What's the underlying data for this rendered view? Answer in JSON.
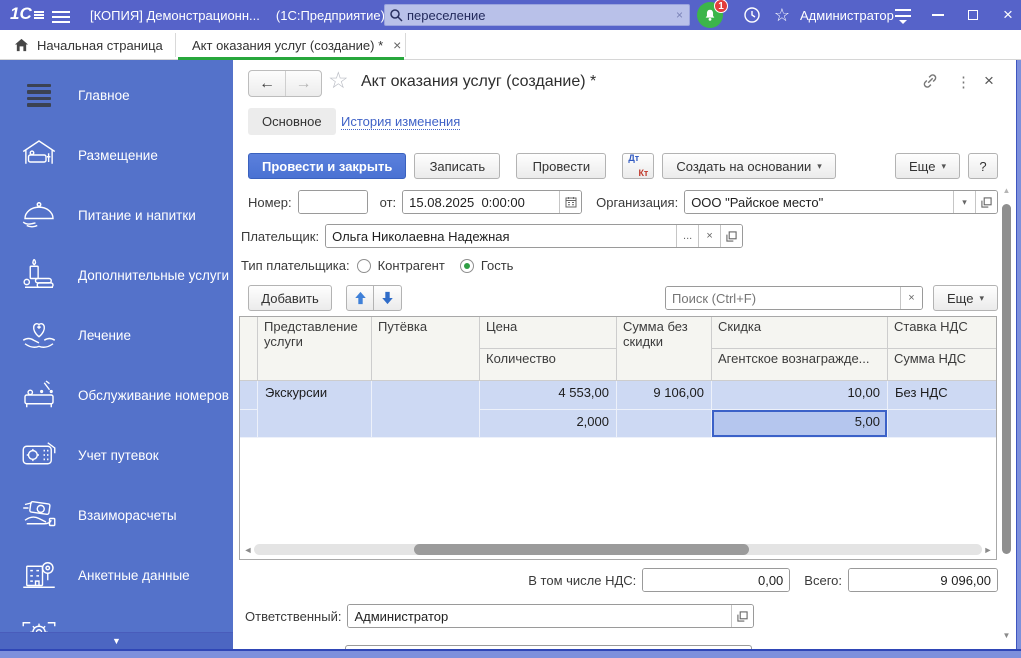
{
  "colors": {
    "topbar": "#5663c9",
    "sidebar": "#5472ca",
    "tab_accent_green": "#27a73c",
    "primary_button": "#4a72d3",
    "row_selection": "#cdd9f3",
    "selected_cell": "#b5c6ee",
    "notification_green": "#3cb54a",
    "badge_red": "#e23d3d"
  },
  "glyphs": {
    "back": "←",
    "forward": "→",
    "dropdown": "▾",
    "close": "×",
    "star": "☆",
    "kebab": "⋮",
    "left_arrow": "◄",
    "right_arrow": "►",
    "up_small": "▲",
    "down_small": "▼",
    "expander": "▼",
    "ellipsis": "..."
  },
  "titlebar": {
    "logo": "1С",
    "app_title_left": "[КОПИЯ] Демонстрационн...",
    "app_title_right": "(1С:Предприятие)",
    "search_value": "переселение",
    "notification_badge": "1",
    "user": "Администратор"
  },
  "tabbar": {
    "home_label": "Начальная страница",
    "active_tab_label": "Акт оказания услуг (создание) *"
  },
  "sidebar": {
    "items": [
      {
        "icon": "menu-icon",
        "label": "Главное"
      },
      {
        "icon": "bed-icon",
        "label": "Размещение"
      },
      {
        "icon": "cloche-icon",
        "label": "Питание и напитки"
      },
      {
        "icon": "spa-icon",
        "label": "Дополнительные услуги"
      },
      {
        "icon": "heart-hands-icon",
        "label": "Лечение"
      },
      {
        "icon": "housekeeping-icon",
        "label": "Обслуживание номеров"
      },
      {
        "icon": "voucher-icon",
        "label": "Учет путевок"
      },
      {
        "icon": "payments-icon",
        "label": "Взаиморасчеты"
      },
      {
        "icon": "building-pin-icon",
        "label": "Анкетные данные"
      },
      {
        "icon": "gear-icon",
        "label": ""
      }
    ]
  },
  "doc": {
    "title": "Акт оказания услуг (создание) *",
    "tab_main": "Основное",
    "tab_history": "История изменения",
    "toolbar": {
      "post_close": "Провести и закрыть",
      "write": "Записать",
      "post": "Провести",
      "dt": "Дт",
      "kt": "Кт",
      "create_based": "Создать на основании",
      "more": "Еще",
      "help": "?"
    },
    "fields": {
      "number_label": "Номер:",
      "number_value": "",
      "date_label": "от:",
      "date_value": "15.08.2025  0:00:00",
      "org_label": "Организация:",
      "org_value": "ООО \"Райское место\"",
      "payer_label": "Плательщик:",
      "payer_value": "Ольга Николаевна Надежная",
      "payer_type_label": "Тип плательщика:",
      "payer_type_option1": "Контрагент",
      "payer_type_option2": "Гость",
      "payer_type_selected": "Гость"
    },
    "grid_toolbar": {
      "add": "Добавить",
      "search_placeholder": "Поиск (Ctrl+F)",
      "more": "Еще"
    },
    "table": {
      "cols": {
        "service": "Представление услуги",
        "voucher": "Путёвка",
        "price": "Цена",
        "qty": "Количество",
        "sum_no_discount": "Сумма без скидки",
        "discount": "Скидка",
        "agent_fee": "Агентское вознагражде...",
        "vat_rate": "Ставка НДС",
        "vat_sum": "Сумма НДС"
      },
      "rows": [
        {
          "service": "Экскурсии",
          "voucher": "",
          "price": "4 553,00",
          "qty": "2,000",
          "sum_no_discount": "9 106,00",
          "discount": "10,00",
          "agent_fee": "5,00",
          "vat_rate": "Без НДС",
          "vat_sum": ""
        }
      ]
    },
    "totals": {
      "vat_label": "В том числе НДС:",
      "vat_value": "0,00",
      "total_label": "Всего:",
      "total_value": "9 096,00"
    },
    "responsible_label": "Ответственный:",
    "responsible_value": "Администратор"
  }
}
